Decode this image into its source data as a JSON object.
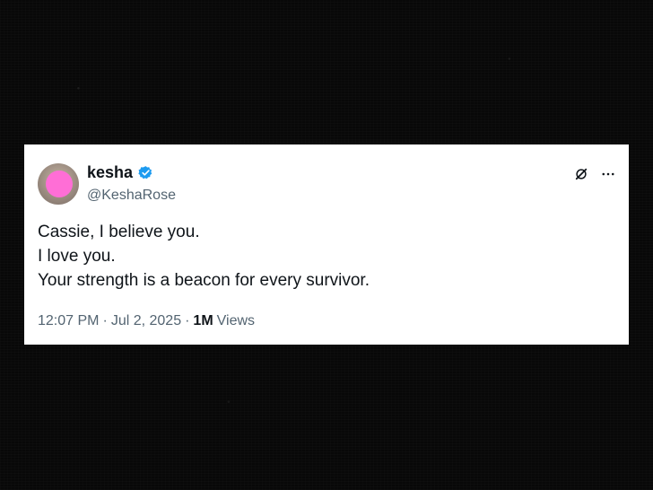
{
  "tweet": {
    "display_name": "kesha",
    "handle": "@KeshaRose",
    "lines": [
      "Cassie, I believe you.",
      "I love you.",
      "Your strength is a beacon for every survivor."
    ],
    "time": "12:07 PM",
    "separator": "·",
    "date": "Jul 2, 2025",
    "views_count": "1M",
    "views_label": "Views"
  },
  "icons": {
    "verified": "verified-badge-icon",
    "grok": "grok-icon",
    "more": "more-icon"
  },
  "colors": {
    "text": "#0f1419",
    "muted": "#536471",
    "verified": "#1d9bf0",
    "avatar_blur": "#ff6ed6"
  }
}
